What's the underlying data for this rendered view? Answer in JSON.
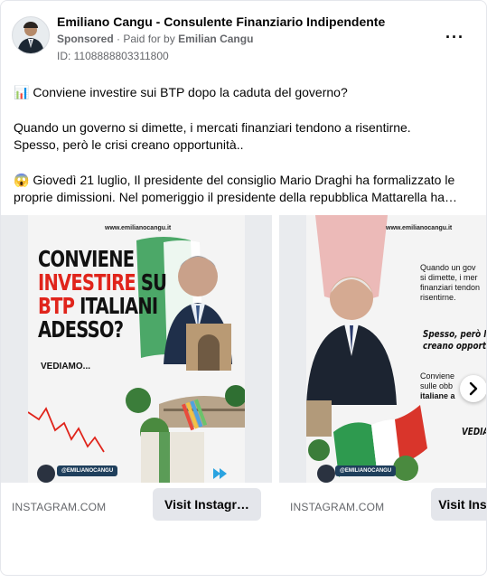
{
  "post": {
    "author": "Emiliano Cangu - Consulente Finanziario Indipendente",
    "sponsored_label": "Sponsored",
    "paid_for_prefix": "Paid for by",
    "paid_for_name": "Emilian Cangu",
    "ad_id": "ID: 1108888803311800",
    "more_label": "···",
    "text": {
      "line1": "📊 Conviene investire sui BTP dopo la caduta del governo?",
      "line2": "Quando un governo si dimette, i mercati finanziari tendono a risentirne.",
      "line3": "Spesso, però le crisi creano opportunità..",
      "line4": "😱 Giovedì 21 luglio, Il presidente del consiglio Mario Draghi ha formalizzato le",
      "line5": "proprie dimissioni. Nel pomeriggio il presidente della repubblica Mattarella ha…"
    }
  },
  "carousel": {
    "cards": [
      {
        "source": "INSTAGRAM.COM",
        "cta": "Visit Instagr…",
        "poster": {
          "url": "www.emilianocangu.it",
          "headline_l1": "CONVIENE",
          "headline_l2": "INVESTIRE SU",
          "headline_l2_red": "INVESTIRE",
          "headline_l2_rest": " SU",
          "headline_l3_red": "BTP",
          "headline_l3_rest": " ITALIANI",
          "headline_l4": "ADESSO?",
          "subtext": "VEDIAMO...",
          "handle": "@EMILIANOCANGU"
        }
      },
      {
        "source": "INSTAGRAM.COM",
        "cta": "Visit Ins",
        "poster": {
          "url": "www.emilianocangu.it",
          "text_l1": "Quando un gov",
          "text_l2": "si dimette, i mer",
          "text_l3": "finanziari tendon",
          "text_l4": "risentirne.",
          "bold_l1": "Spesso, però le",
          "bold_l2": "creano opportun",
          "note_l1": "Conviene",
          "note_l2": "sulle obb",
          "note_l3": "italiane a",
          "vediamo": "VEDIAM",
          "handle": "@EMILIANOCANGU"
        }
      }
    ],
    "next_icon": "chevron-right-icon"
  },
  "colors": {
    "accent_red": "#e0241b",
    "flag_green": "#2e9a4f",
    "flag_red": "#d9352b"
  }
}
